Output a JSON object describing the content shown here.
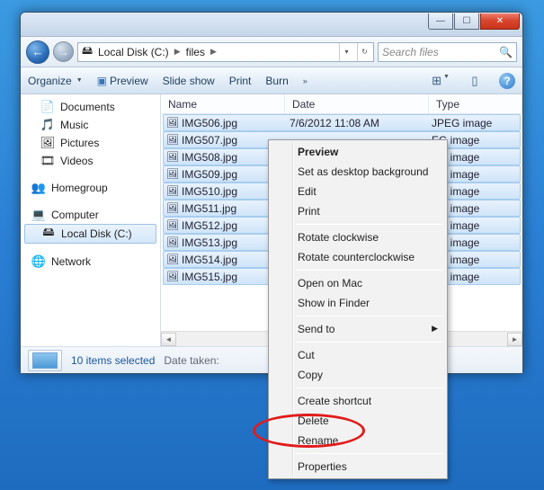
{
  "breadcrumb": {
    "drive": "Local Disk (C:)",
    "folder": "files"
  },
  "search": {
    "placeholder": "Search files"
  },
  "toolbar": {
    "organize": "Organize",
    "preview": "Preview",
    "slideshow": "Slide show",
    "print": "Print",
    "burn": "Burn"
  },
  "sidebar": {
    "libs": [
      "Documents",
      "Music",
      "Pictures",
      "Videos"
    ],
    "homegroup": "Homegroup",
    "computer": "Computer",
    "drive": "Local Disk (C:)",
    "network": "Network"
  },
  "columns": {
    "name": "Name",
    "date": "Date",
    "type": "Type"
  },
  "files": [
    {
      "name": "IMG506.jpg",
      "date": "7/6/2012 11:08 AM",
      "type": "JPEG image"
    },
    {
      "name": "IMG507.jpg",
      "date": "",
      "type": "EG image"
    },
    {
      "name": "IMG508.jpg",
      "date": "",
      "type": "EG image"
    },
    {
      "name": "IMG509.jpg",
      "date": "",
      "type": "EG image"
    },
    {
      "name": "IMG510.jpg",
      "date": "",
      "type": "EG image"
    },
    {
      "name": "IMG511.jpg",
      "date": "",
      "type": "EG image"
    },
    {
      "name": "IMG512.jpg",
      "date": "",
      "type": "EG image"
    },
    {
      "name": "IMG513.jpg",
      "date": "",
      "type": "EG image"
    },
    {
      "name": "IMG514.jpg",
      "date": "",
      "type": "EG image"
    },
    {
      "name": "IMG515.jpg",
      "date": "",
      "type": "EG image"
    }
  ],
  "status": {
    "selected": "10 items selected",
    "meta": "Date taken:"
  },
  "context": {
    "preview": "Preview",
    "setbg": "Set as desktop background",
    "edit": "Edit",
    "print": "Print",
    "rotcw": "Rotate clockwise",
    "rotccw": "Rotate counterclockwise",
    "openmac": "Open on Mac",
    "finder": "Show in Finder",
    "sendto": "Send to",
    "cut": "Cut",
    "copy": "Copy",
    "shortcut": "Create shortcut",
    "delete": "Delete",
    "rename": "Rename",
    "properties": "Properties"
  }
}
